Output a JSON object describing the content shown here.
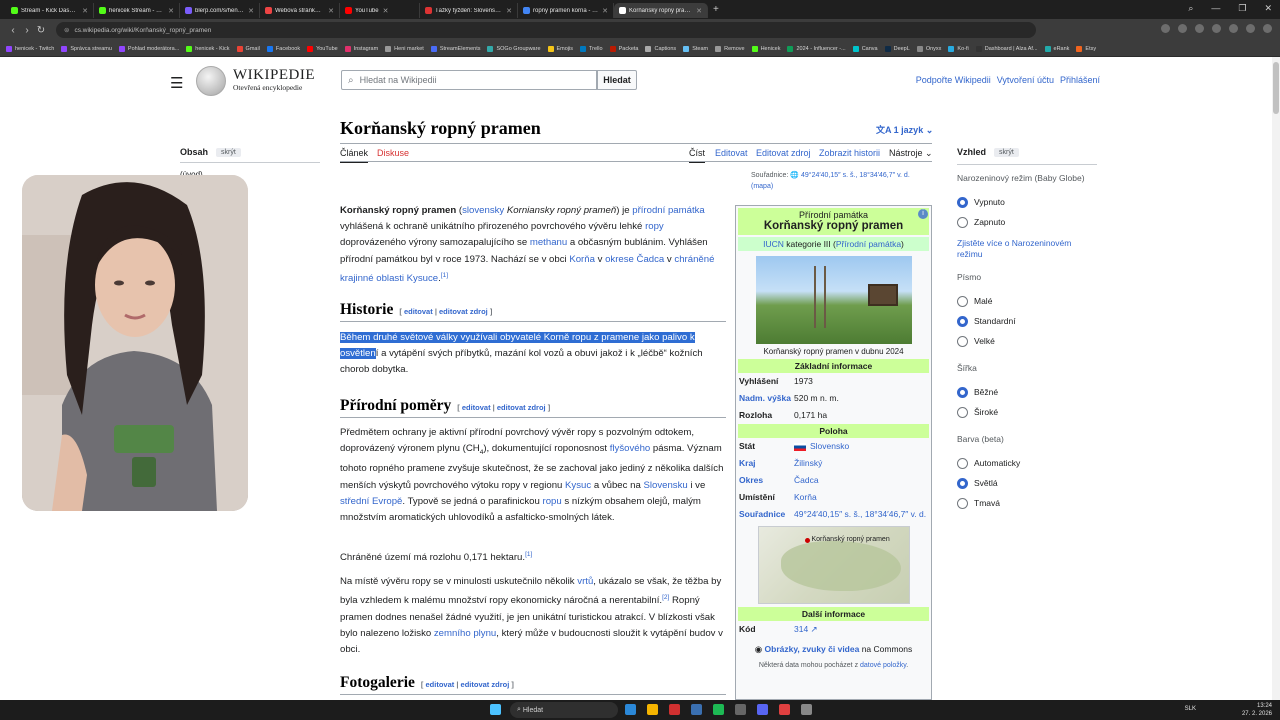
{
  "browser": {
    "tabs": [
      {
        "title": "Stream - Kick Dashboard",
        "color": "#53fc18"
      },
      {
        "title": "henicek Stream - Watch L",
        "color": "#53fc18"
      },
      {
        "title": "blerp.com/s/henicek",
        "color": "#7a5cfa"
      },
      {
        "title": "Webová stránka historie",
        "color": "#e44"
      },
      {
        "title": "YouTube",
        "color": "#ff0000"
      },
      {
        "title": "Ťažký týždeň: Slovensko b",
        "color": "#d33"
      },
      {
        "title": "ropny pramen korna - HĽ",
        "color": "#4285f4"
      },
      {
        "title": "Korňanský ropný pramen",
        "color": "#ffffff"
      }
    ],
    "new_tab": "+",
    "window_controls": [
      "⌕",
      "—",
      "❐",
      "✕"
    ],
    "url": "cs.wikipedia.org/wiki/Korňanský_ropný_pramen",
    "nav": [
      "‹",
      "›",
      "↻"
    ],
    "bookmarks": [
      {
        "label": "henicek - Twitch",
        "color": "#9146ff"
      },
      {
        "label": "Správca streamu",
        "color": "#9146ff"
      },
      {
        "label": "Pohlad moderátora...",
        "color": "#9146ff"
      },
      {
        "label": "henicek - Kick",
        "color": "#53fc18"
      },
      {
        "label": "Gmail",
        "color": "#ea4335"
      },
      {
        "label": "Facebook",
        "color": "#1877f2"
      },
      {
        "label": "YouTube",
        "color": "#ff0000"
      },
      {
        "label": "Instagram",
        "color": "#e1306c"
      },
      {
        "label": "Heni market",
        "color": "#999999"
      },
      {
        "label": "StreamElements",
        "color": "#4a6cf7"
      },
      {
        "label": "SOGo Groupware",
        "color": "#3aa"
      },
      {
        "label": "Emojis",
        "color": "#f5c518"
      },
      {
        "label": "Trello",
        "color": "#0079bf"
      },
      {
        "label": "Packeta",
        "color": "#ba1b02"
      },
      {
        "label": "Captions",
        "color": "#aaaaaa"
      },
      {
        "label": "Steam",
        "color": "#66c0f4"
      },
      {
        "label": "Remove",
        "color": "#999999"
      },
      {
        "label": "Henicek",
        "color": "#53fc18"
      },
      {
        "label": "2024 - Influencer -...",
        "color": "#0f9d58"
      },
      {
        "label": "Canva",
        "color": "#00c4cc"
      },
      {
        "label": "DeepL",
        "color": "#0f2b46"
      },
      {
        "label": "Onyxx",
        "color": "#888888"
      },
      {
        "label": "Ko-fi",
        "color": "#29abe0"
      },
      {
        "label": "Dashboard | Alza Af...",
        "color": "#333333"
      },
      {
        "label": "eRank",
        "color": "#2aa"
      },
      {
        "label": "Etsy",
        "color": "#f1641e"
      }
    ]
  },
  "wiki": {
    "logo_title": "WIKIPEDIE",
    "logo_tagline": "Otevřená encyklopedie",
    "search_placeholder": "Hledat na Wikipedii",
    "search_button": "Hledat",
    "user_links": [
      "Podpořte Wikipedii",
      "Vytvoření účtu",
      "Přihlášení"
    ],
    "toc": {
      "title": "Obsah",
      "hide": "skrýt",
      "first": "(úvod)"
    },
    "article_title": "Korňanský ropný pramen",
    "languages": "1 jazyk",
    "tabs_left": [
      "Článek",
      "Diskuse"
    ],
    "tabs_right": [
      "Číst",
      "Editovat",
      "Editovat zdroj",
      "Zobrazit historii",
      "Nástroje"
    ],
    "coords_top": {
      "label": "Souřadnice:",
      "value": "49°24′40,15″ s. š., 18°34′46,7″ v. d.",
      "map": "(mapa)"
    },
    "intro": {
      "bold": "Korňanský ropný pramen",
      "t1": " (",
      "l1": "slovensky",
      "t2": " ",
      "it": "Korniansky ropný prameň",
      "t3": ") je ",
      "l2": "přírodní památka",
      "t4": " vyhlášená k ochraně unikátního přirozeného povrchového vývěru lehké ",
      "l3": "ropy",
      "t5": " doprovázeného výrony samozapalujícího se ",
      "l4": "methanu",
      "t6": " a občasným bublánim. Vyhlášen přírodní památkou byl v roce 1973. Nachází se v obci ",
      "l5": "Korňa",
      "t7": " v ",
      "l6": "okrese Čadca",
      "t8": " v ",
      "l7": "chráněné krajinné oblasti Kysuce",
      "t9": ".",
      "ref": "[1]"
    },
    "sections": {
      "historie": "Historie",
      "prirodni": "Přírodní poměry",
      "fotogalerie": "Fotogalerie",
      "edit": "editovat",
      "edit_source": "editovat zdroj"
    },
    "historie_para": {
      "selected": "Během druhé světové války využívali obyvatelé Korně ropu z pramene jako palivo k osvětlen",
      "rest": "í a vytápění svých příbytků, mazání kol vozů a obuvi jakož i k „léčbě“ kožních chorob dobytka."
    },
    "prirodni_para1": {
      "t1": "Předmětem ochrany je aktivní přírodní povrchový vývěr ropy s pozvolným odtokem, doprovázený výronem plynu (CH",
      "sub": "4",
      "t2": "), dokumentující roponosnost ",
      "l1": "flyšového",
      "t3": " pásma. Význam tohoto ropného pramene zvyšuje skutečnost, že se zachoval jako jediný z několika dalších menších výskytů povrchového výtoku ropy v regionu ",
      "l2": "Kysuc",
      "t4": " a vůbec na ",
      "l3": "Slovensku",
      "t5": " i ve ",
      "l4": "střední Evropě",
      "t6": ". Typově se jedná o parafinickou ",
      "l5": "ropu",
      "t7": " s nízkým obsahem olejů, malým množstvím aromatických uhlovodíků a asfalticko-smolných látek."
    },
    "prirodni_para2": {
      "t1": "Chráněné území má rozlohu 0,171 hektaru.",
      "ref": "[1]"
    },
    "prirodni_para3": {
      "t1": "Na místě vývěru ropy se v minulosti uskutečnilo několik ",
      "l1": "vrtů",
      "t2": ", ukázalo se však, že těžba by byla vzhledem k malému množství ropy ekonomicky náročná a nerentabilní.",
      "ref": "[2]",
      "t3": " Ropný pramen dodnes nenašel žádné využití, je jen unikátní turistickou atrakcí. V blízkosti však bylo nalezeno ložisko ",
      "l2": "zemního plynu",
      "t4": ", který může v budoucnosti sloužit k vytápění budov v obci."
    },
    "infobox": {
      "kind": "Přírodní památka",
      "name": "Korňanský ropný pramen",
      "info_icon": "i",
      "iucn_link": "IUCN",
      "iucn_text": " kategorie III (",
      "iucn_cat": "Přírodní památka",
      "iucn_end": ")",
      "caption": "Korňanský ropný pramen v dubnu 2024",
      "sec_basic": "Základní informace",
      "rows_basic": [
        {
          "k": "Vyhlášení",
          "v": "1973",
          "klink": false
        },
        {
          "k": "Nadm. výška",
          "v": "520 m n. m.",
          "klink": true
        },
        {
          "k": "Rozloha",
          "v": "0,171 ha",
          "klink": false
        }
      ],
      "sec_pos": "Poloha",
      "rows_pos": [
        {
          "k": "Stát",
          "v": "Slovensko",
          "flag": true
        },
        {
          "k": "Kraj",
          "v": "Žilinský",
          "klink": true
        },
        {
          "k": "Okres",
          "v": "Čadca",
          "klink": true
        },
        {
          "k": "Umístění",
          "v": "Korňa",
          "klink": false
        },
        {
          "k": "Souřadnice",
          "v": "49°24′40,15″ s. š., 18°34′46,7″ v. d.",
          "klink": true
        }
      ],
      "map_label": "Korňanský ropný pramen",
      "sec_more": "Další informace",
      "row_code": {
        "k": "Kód",
        "v": "314"
      },
      "commons_link": "Obrázky, zvuky či videa",
      "commons_text": " na Commons",
      "note_text": "Některá data mohou pocházet z ",
      "note_link": "datové položky",
      "note_end": "."
    },
    "appearance": {
      "title": "Vzhled",
      "hide": "skrýt",
      "birthday_label": "Narozeninový režim (Baby Globe)",
      "birthday_options": [
        "Vypnuto",
        "Zapnuto"
      ],
      "birthday_selected": 0,
      "more_link": "Zjistěte více o Narozeninovém režimu",
      "font_label": "Písmo",
      "font_options": [
        "Malé",
        "Standardní",
        "Velké"
      ],
      "font_selected": 1,
      "width_label": "Šířka",
      "width_options": [
        "Běžné",
        "Široké"
      ],
      "width_selected": 0,
      "color_label": "Barva (beta)",
      "color_options": [
        "Automaticky",
        "Světlá",
        "Tmavá"
      ],
      "color_selected": 1
    }
  },
  "taskbar": {
    "search": "Hledat",
    "lang": "SLK",
    "time": "13:24",
    "date": "27. 2. 2026",
    "apps": [
      {
        "color": "#2b88d8"
      },
      {
        "color": "#f5b400"
      },
      {
        "color": "#d03030"
      },
      {
        "color": "#3a6fb0"
      },
      {
        "color": "#1db954"
      },
      {
        "color": "#666666"
      },
      {
        "color": "#5865f2"
      },
      {
        "color": "#e04040"
      },
      {
        "color": "#888888"
      }
    ]
  }
}
